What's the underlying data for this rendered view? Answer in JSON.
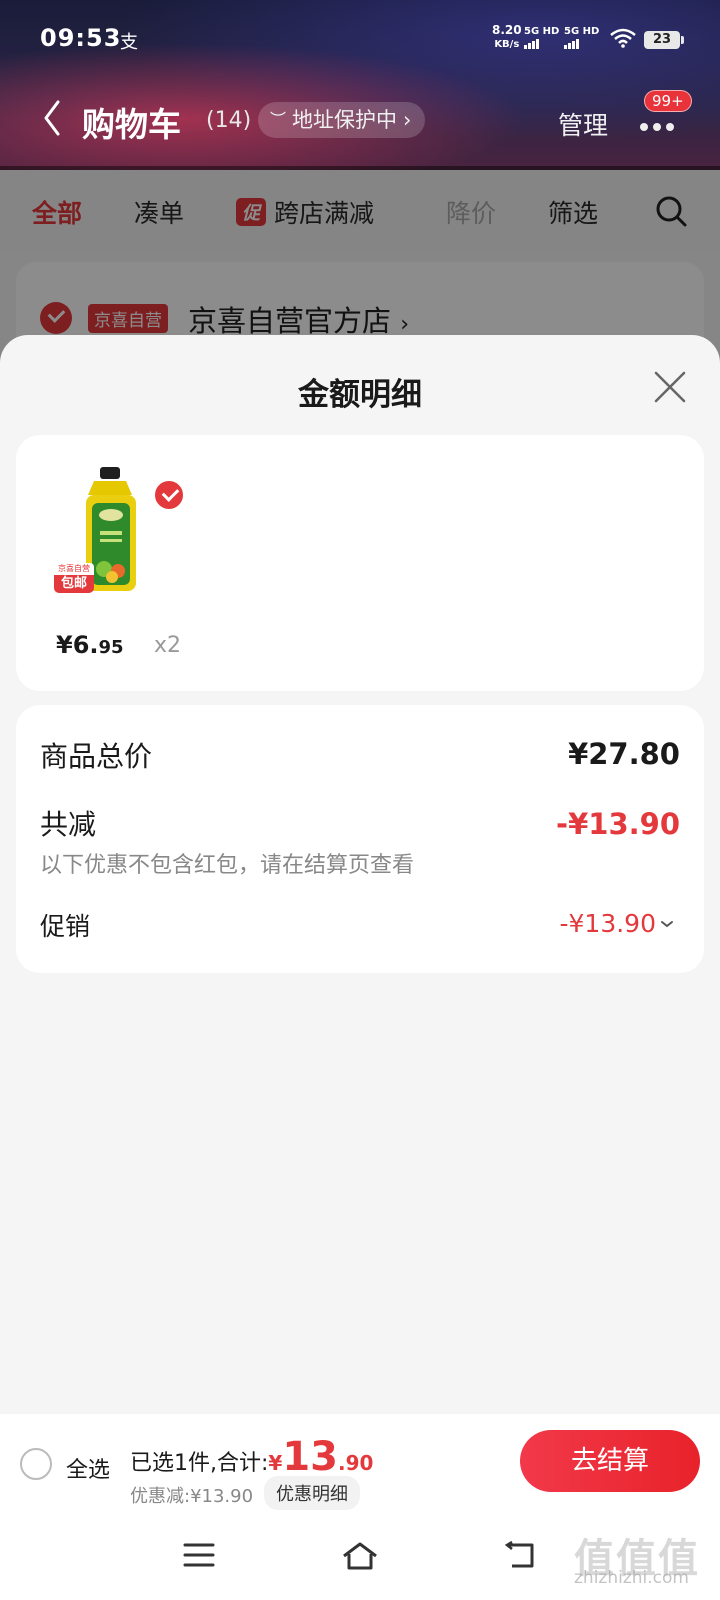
{
  "status_bar": {
    "time": "09:53",
    "app_glyph": "支",
    "net_speed": "8.20",
    "net_unit": "KB/s",
    "sim1": "5G HD",
    "sim2": "5G HD",
    "battery": "23"
  },
  "header": {
    "title": "购物车",
    "count": "(14)",
    "address_protect": "地址保护中",
    "address_chevron": "›",
    "manage": "管理",
    "badge": "99+"
  },
  "tabs": {
    "all": "全部",
    "combine": "凑单",
    "promo_tag": "促",
    "cross_store": "跨店满减",
    "price_drop": "降价",
    "filter": "筛选"
  },
  "store": {
    "tag": "京喜自营",
    "name": "京喜自营官方店",
    "chevron": "›"
  },
  "sheet": {
    "title": "金额明细",
    "item": {
      "ship_tag_top": "京喜自营",
      "ship_tag": "包邮",
      "price_main": "¥6.",
      "price_dec": "95",
      "qty": "x2"
    },
    "total_label": "商品总价",
    "total_value": "¥27.80",
    "reduce_label": "共减",
    "reduce_value": "-¥13.90",
    "note": "以下优惠不包含红包，请在结算页查看",
    "promo_label": "促销",
    "promo_value": "-¥13.90"
  },
  "checkout": {
    "select_all": "全选",
    "selected_text": "已选1件,合计:",
    "currency": "¥",
    "total_int": "13",
    "total_dec": ".90",
    "discount_text": "优惠减:¥13.90",
    "discount_detail": "优惠明细",
    "button": "去结算"
  },
  "watermark": {
    "main": "值值值",
    "sub": "zhizhizhi.com"
  },
  "colors": {
    "accent": "#e4393c",
    "background": "#f5f5f5"
  }
}
